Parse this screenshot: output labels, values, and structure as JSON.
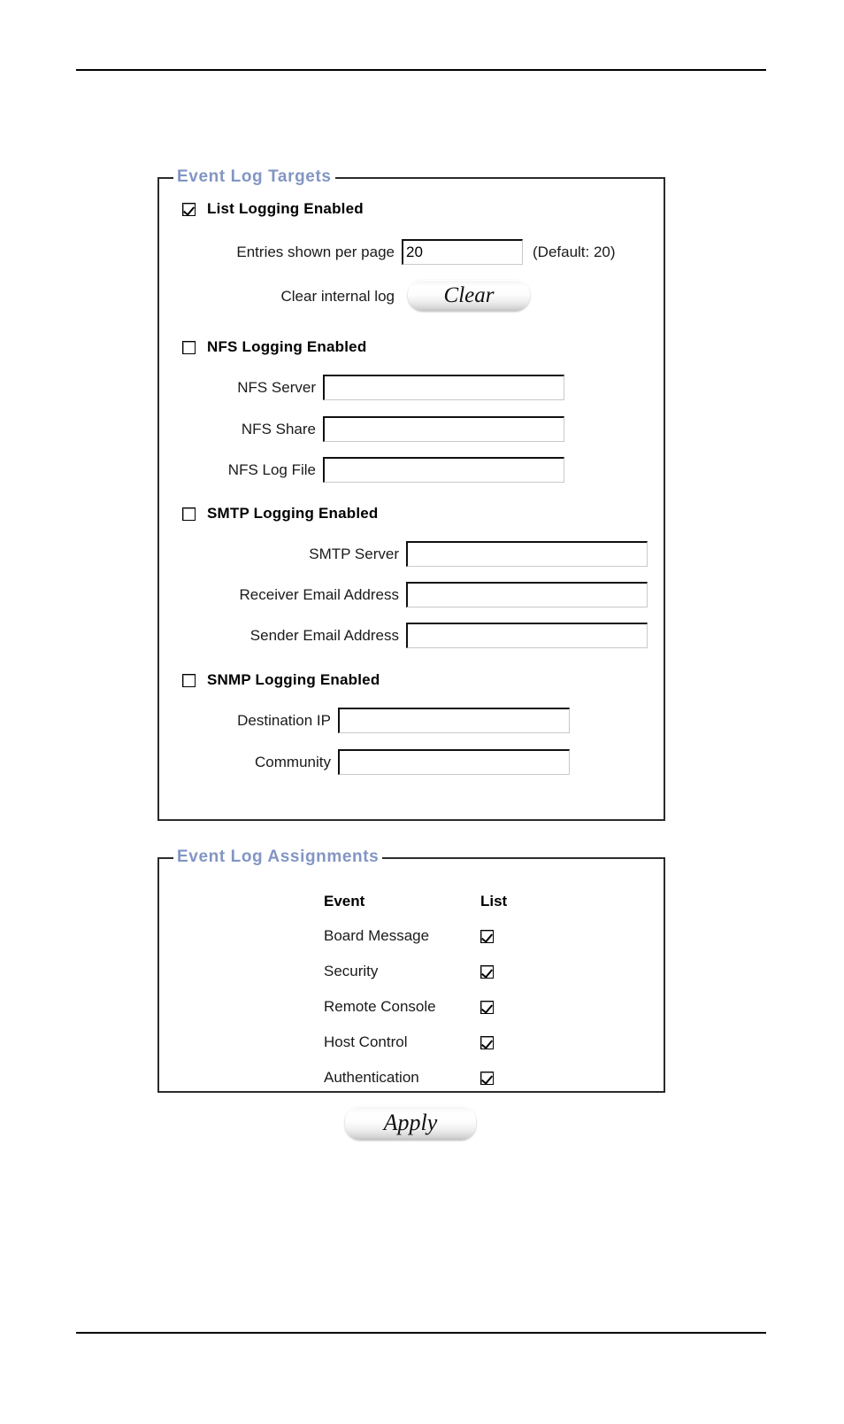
{
  "page": {
    "top_rule": "horizontal-rule",
    "bottom_rule": "horizontal-rule"
  },
  "targets": {
    "legend": "Event Log Targets",
    "groups": [
      {
        "id": "list",
        "label": "List Logging Enabled",
        "checked": true,
        "fields": [
          {
            "label": "Entries shown per page",
            "value": "20",
            "placeholder": "",
            "suffix": "(Default: 20)"
          }
        ],
        "action": {
          "label": "Clear internal log",
          "button_label": "Clear"
        }
      },
      {
        "id": "nfs",
        "label": "NFS Logging Enabled",
        "checked": false,
        "fields": [
          {
            "label": "NFS Server",
            "value": "",
            "placeholder": ""
          },
          {
            "label": "NFS Share",
            "value": "",
            "placeholder": ""
          },
          {
            "label": "NFS Log File",
            "value": "",
            "placeholder": ""
          }
        ]
      },
      {
        "id": "smtp",
        "label": "SMTP Logging Enabled",
        "checked": false,
        "fields": [
          {
            "label": "SMTP Server",
            "value": "",
            "placeholder": ""
          },
          {
            "label": "Receiver Email Address",
            "value": "",
            "placeholder": ""
          },
          {
            "label": "Sender Email Address",
            "value": "",
            "placeholder": ""
          }
        ]
      },
      {
        "id": "snmp",
        "label": "SNMP Logging Enabled",
        "checked": false,
        "fields": [
          {
            "label": "Destination IP",
            "value": "",
            "placeholder": ""
          },
          {
            "label": "Community",
            "value": "",
            "placeholder": ""
          }
        ]
      }
    ]
  },
  "assignments": {
    "legend": "Event Log Assignments",
    "columns": [
      "Event",
      "List"
    ],
    "rows": [
      {
        "event": "Board Message",
        "list": true
      },
      {
        "event": "Security",
        "list": true
      },
      {
        "event": "Remote Console",
        "list": true
      },
      {
        "event": "Host Control",
        "list": true
      },
      {
        "event": "Authentication",
        "list": true
      }
    ]
  },
  "apply": {
    "label": "Apply"
  },
  "colors": {
    "legend": "#8295c4",
    "border": "#2b2b2b",
    "text": "#000000",
    "background": "#ffffff"
  }
}
